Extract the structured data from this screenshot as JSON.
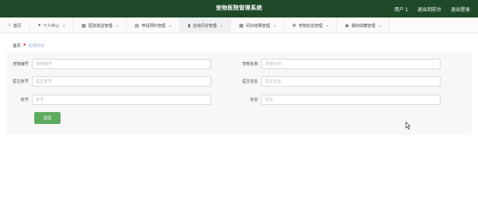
{
  "header": {
    "title": "宠物医院管理系统",
    "user": "用户 1",
    "exit_backend": "退出到前台",
    "logout": "退出登录"
  },
  "nav": [
    {
      "label": "首页",
      "icon": "home-icon",
      "glyph": "⌂"
    },
    {
      "label": "个人中心",
      "icon": "person-icon",
      "glyph": "●"
    },
    {
      "label": "医院进驻管理",
      "icon": "grid-icon",
      "glyph": "▦"
    },
    {
      "label": "申请预约管理",
      "icon": "table-icon",
      "glyph": "▤"
    },
    {
      "label": "在线问诊管理",
      "icon": "chart-icon",
      "glyph": "▮"
    },
    {
      "label": "问诊结果管理",
      "icon": "grid-icon",
      "glyph": "▦"
    },
    {
      "label": "宠物信息管理",
      "icon": "settings-icon",
      "glyph": "✻"
    },
    {
      "label": "我的收藏管理",
      "icon": "pin-icon",
      "glyph": "◉"
    }
  ],
  "nav_active_index": 4,
  "breadcrumb": {
    "home": "首页",
    "current": "在线问诊"
  },
  "form": {
    "pet_id_label": "宠物编号",
    "pet_id_placeholder": "宠物编号",
    "pet_name_label": "宠物名称",
    "pet_name_placeholder": "宠物名称",
    "doctor_id_label": "医生账号",
    "doctor_id_placeholder": "医生账号",
    "doctor_name_label": "医生姓名",
    "doctor_name_placeholder": "医生姓名",
    "account_label": "账号",
    "account_placeholder": "账号",
    "name_label": "姓名",
    "name_placeholder": "姓名",
    "back_button": "返回"
  },
  "colors": {
    "header_bg": "#1f4a2a",
    "button_bg": "#5daa5e",
    "heart": "#e03a3a"
  }
}
